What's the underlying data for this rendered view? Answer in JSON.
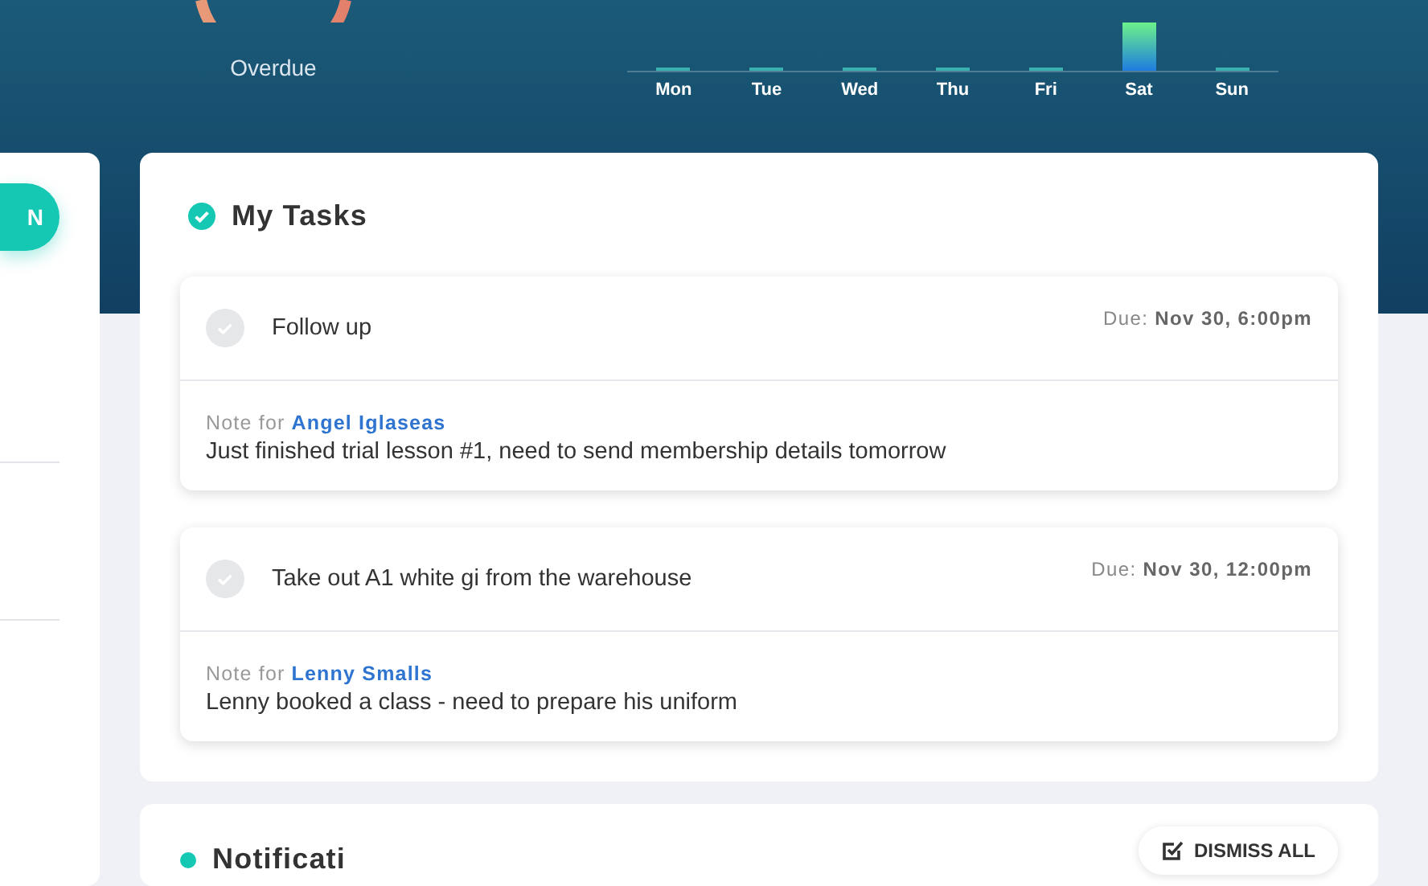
{
  "overdue": {
    "label": "Overdue"
  },
  "weekly_chart": {
    "days": [
      {
        "label": "Mon",
        "active": false
      },
      {
        "label": "Tue",
        "active": false
      },
      {
        "label": "Wed",
        "active": false
      },
      {
        "label": "Thu",
        "active": false
      },
      {
        "label": "Fri",
        "active": false
      },
      {
        "label": "Sat",
        "active": true
      },
      {
        "label": "Sun",
        "active": false
      }
    ]
  },
  "sidebar": {
    "button": {
      "label": "N"
    }
  },
  "tasks_panel": {
    "title": "My Tasks",
    "tasks": [
      {
        "title": "Follow up",
        "completed": false,
        "due": "Due: **Nov 30, 6:00pm**",
        "note_prefix": "Note for",
        "note_for": "Angel Iglaseas",
        "note": "Just finished trial lesson #1, need to send membership details tomorrow"
      },
      {
        "title": "Take out A1 white gi from the warehouse",
        "completed": false,
        "due": "Due: **Nov 30, 12:00pm**",
        "note_prefix": "Note for",
        "note_for": "Lenny Smalls",
        "note": "Lenny booked a class - need to prepare his uniform"
      }
    ]
  },
  "notifications_panel": {
    "title": "Notificati",
    "dismiss_button": "DISMISS ALL"
  }
}
